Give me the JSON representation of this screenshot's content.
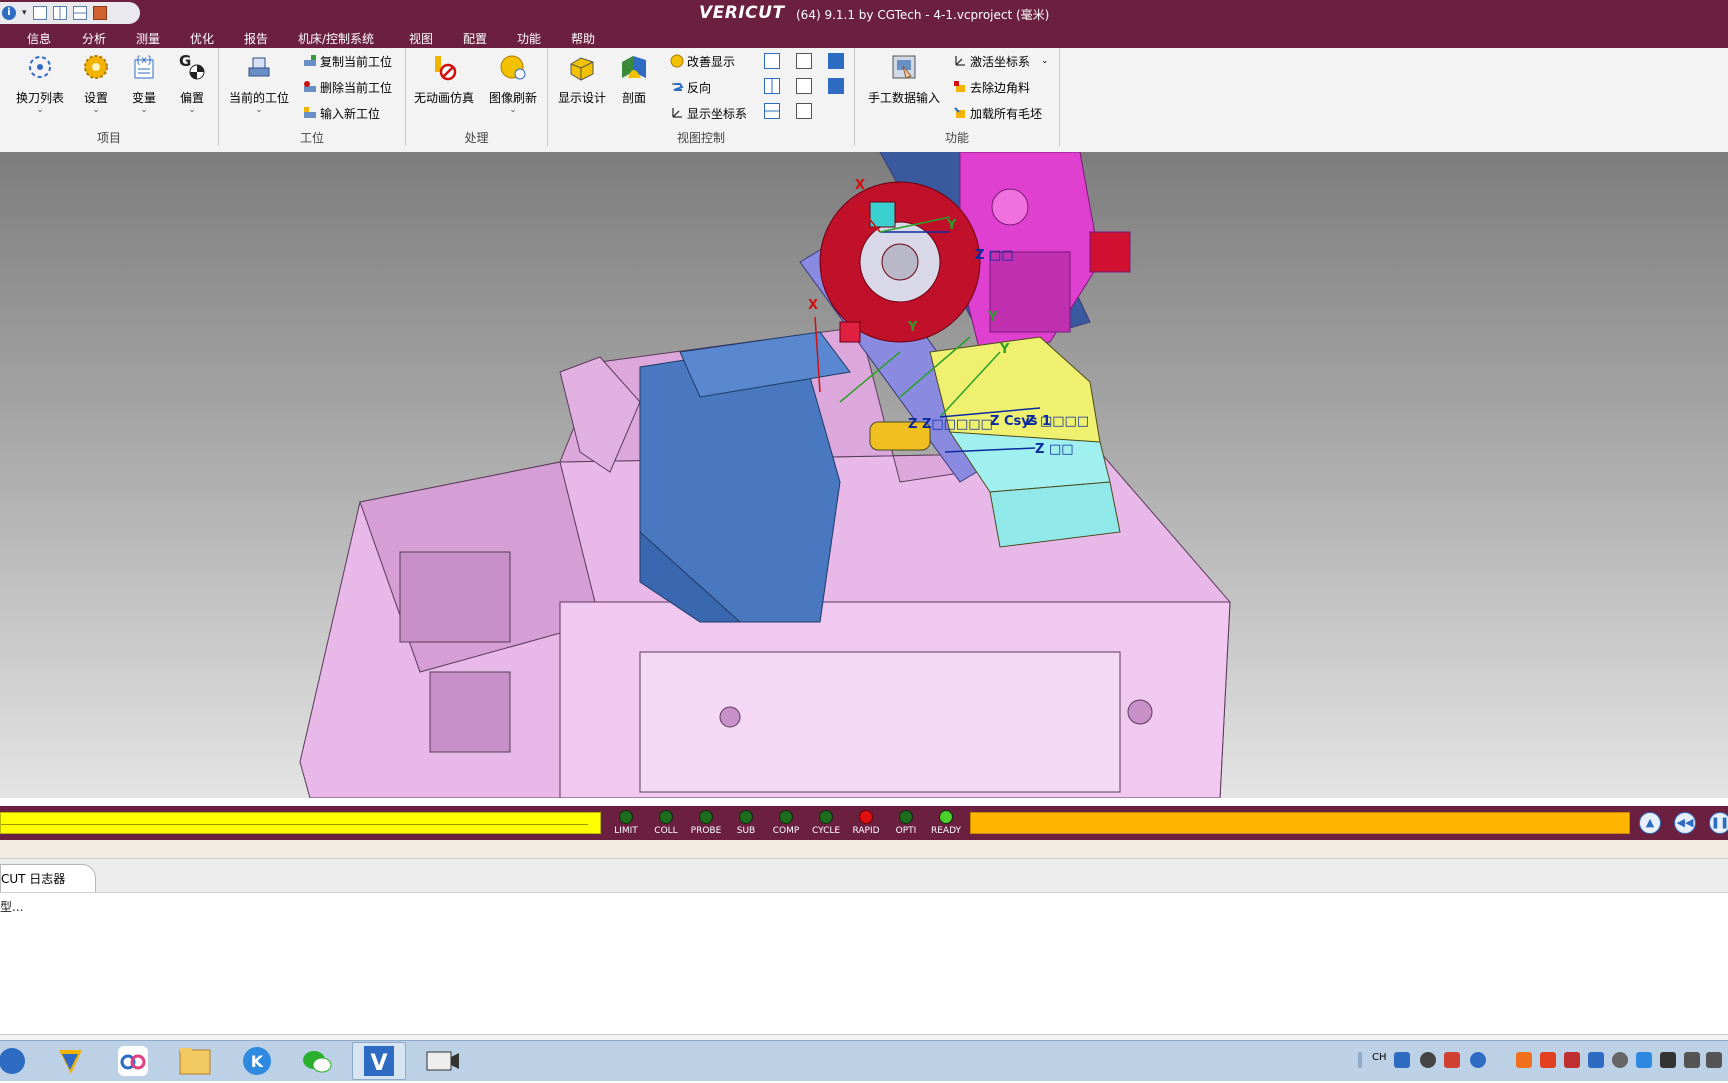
{
  "title_bar": {
    "app_name": "VERICUT",
    "title": "(64)  9.1.1 by CGTech - 4-1.vcproject (毫米)"
  },
  "menu": [
    "信息",
    "分析",
    "测量",
    "优化",
    "报告",
    "机床/控制系统",
    "视图",
    "配置",
    "功能",
    "帮助"
  ],
  "ribbon": {
    "project": {
      "label": "项目",
      "tool_list": "换刀列表",
      "settings": "设置",
      "variables": "变量",
      "offsets": "偏置"
    },
    "setup": {
      "label": "工位",
      "current_setup": "当前的工位",
      "copy": "复制当前工位",
      "delete": "删除当前工位",
      "new": "输入新工位"
    },
    "process": {
      "label": "处理",
      "no_anim": "无动画仿真",
      "refresh": "图像刷新"
    },
    "view_control": {
      "label": "视图控制",
      "display_design": "显示设计",
      "section": "剖面",
      "improve": "改善显示",
      "reverse": "反向",
      "show_csys": "显示坐标系"
    },
    "function": {
      "label": "功能",
      "mdi": "手工数据输入",
      "activate_csys": "激活坐标系",
      "remove_chamfer": "去除边角料",
      "load_stock": "加载所有毛坯"
    }
  },
  "viewport": {
    "axis_labels": {
      "x1": "X",
      "y1": "Y",
      "z1": "Z □□",
      "x2": "X",
      "y2": "Y",
      "y3": "Y",
      "y4": "Y",
      "zmid": "Z Csys 1",
      "zmid2": "Z □□□□",
      "zleft": "Z Z□□□□□",
      "zlow": "Z □□"
    }
  },
  "status_leds": [
    {
      "label": "LIMIT",
      "color": "#1d6b1d"
    },
    {
      "label": "COLL",
      "color": "#1d6b1d"
    },
    {
      "label": "PROBE",
      "color": "#1d6b1d"
    },
    {
      "label": "SUB",
      "color": "#1d6b1d"
    },
    {
      "label": "COMP",
      "color": "#1d6b1d"
    },
    {
      "label": "CYCLE",
      "color": "#1d6b1d"
    },
    {
      "label": "RAPID",
      "color": "#e01010"
    },
    {
      "label": "OPTI",
      "color": "#1d6b1d"
    },
    {
      "label": "READY",
      "color": "#4ccf2a"
    }
  ],
  "logger": {
    "tab": "CUT 日志器",
    "line": "型..."
  },
  "colors": {
    "title_bg": "#6b2040",
    "progress_left": "#ffff00",
    "progress_right": "#ffb400"
  }
}
